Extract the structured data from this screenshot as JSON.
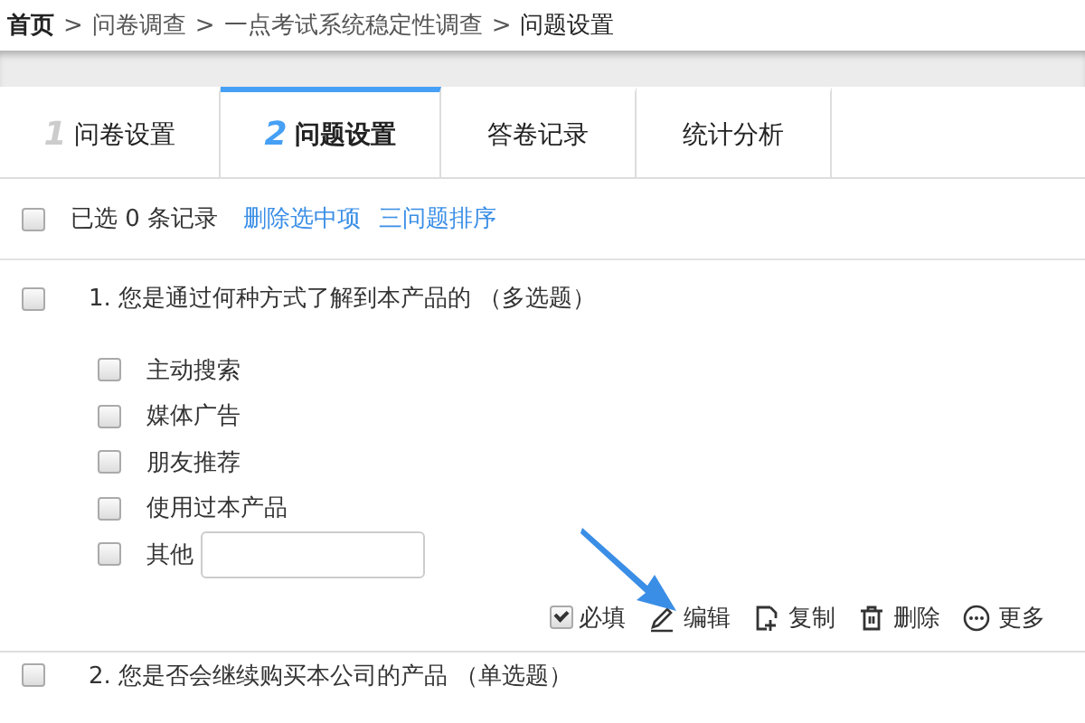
{
  "breadcrumb": [
    {
      "label": "首页",
      "current": false,
      "home": true
    },
    {
      "label": "问卷调查",
      "current": false,
      "home": false
    },
    {
      "label": "一点考试系统稳定性调查",
      "current": false,
      "home": false
    },
    {
      "label": "问题设置",
      "current": true,
      "home": false
    }
  ],
  "breadcrumb_separator": ">",
  "tabs": [
    {
      "number": "1",
      "label": "问卷设置",
      "selected": false
    },
    {
      "number": "2",
      "label": "问题设置",
      "selected": true
    },
    {
      "label": "答卷记录",
      "selected": false
    },
    {
      "label": "统计分析",
      "selected": false
    }
  ],
  "toolbar": {
    "select_all_checked": false,
    "count_text": "已选 0 条记录",
    "delete_link": "删除选中项",
    "sort_link": "三问题排序"
  },
  "questions": [
    {
      "title": "1. 您是通过何种方式了解到本产品的 （多选题）",
      "checked": false,
      "options": [
        {
          "label": "主动搜索",
          "checked": false
        },
        {
          "label": "媒体广告",
          "checked": false
        },
        {
          "label": "朋友推荐",
          "checked": false
        },
        {
          "label": "使用过本产品",
          "checked": false
        },
        {
          "label": "其他",
          "checked": false,
          "kind": "text-input"
        }
      ],
      "required": {
        "label": "必填",
        "checked": true
      },
      "actions": [
        {
          "kind": "edit",
          "label": "编辑"
        },
        {
          "kind": "copy",
          "label": "复制"
        },
        {
          "kind": "delete",
          "label": "删除"
        },
        {
          "kind": "more",
          "label": "更多"
        }
      ]
    },
    {
      "title": "2. 您是否会继续购买本公司的产品 （单选题）",
      "checked": false
    }
  ]
}
